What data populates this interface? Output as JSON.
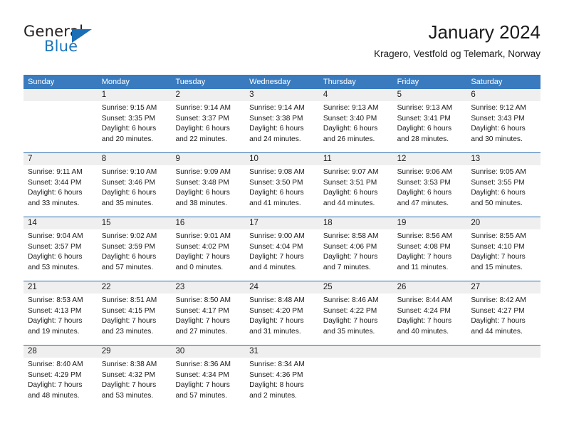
{
  "brand": {
    "name_top": "General",
    "name_bottom": "Blue",
    "triangle_icon": "blue-triangle-logo-icon",
    "color_dark": "#231f20",
    "color_blue": "#1d76bb"
  },
  "header": {
    "title": "January 2024",
    "subtitle": "Kragero, Vestfold og Telemark, Norway"
  },
  "theme": {
    "header_band": "#3a7bbf",
    "row_divider": "#2c6cad",
    "daynum_strip": "#efefef",
    "text": "#1a1a1a"
  },
  "weekdays": [
    "Sunday",
    "Monday",
    "Tuesday",
    "Wednesday",
    "Thursday",
    "Friday",
    "Saturday"
  ],
  "weeks": [
    {
      "numbers": [
        "",
        "1",
        "2",
        "3",
        "4",
        "5",
        "6"
      ],
      "cells": [
        {
          "lines": []
        },
        {
          "lines": [
            "Sunrise: 9:15 AM",
            "Sunset: 3:35 PM",
            "Daylight: 6 hours",
            "and 20 minutes."
          ]
        },
        {
          "lines": [
            "Sunrise: 9:14 AM",
            "Sunset: 3:37 PM",
            "Daylight: 6 hours",
            "and 22 minutes."
          ]
        },
        {
          "lines": [
            "Sunrise: 9:14 AM",
            "Sunset: 3:38 PM",
            "Daylight: 6 hours",
            "and 24 minutes."
          ]
        },
        {
          "lines": [
            "Sunrise: 9:13 AM",
            "Sunset: 3:40 PM",
            "Daylight: 6 hours",
            "and 26 minutes."
          ]
        },
        {
          "lines": [
            "Sunrise: 9:13 AM",
            "Sunset: 3:41 PM",
            "Daylight: 6 hours",
            "and 28 minutes."
          ]
        },
        {
          "lines": [
            "Sunrise: 9:12 AM",
            "Sunset: 3:43 PM",
            "Daylight: 6 hours",
            "and 30 minutes."
          ]
        }
      ]
    },
    {
      "numbers": [
        "7",
        "8",
        "9",
        "10",
        "11",
        "12",
        "13"
      ],
      "cells": [
        {
          "lines": [
            "Sunrise: 9:11 AM",
            "Sunset: 3:44 PM",
            "Daylight: 6 hours",
            "and 33 minutes."
          ]
        },
        {
          "lines": [
            "Sunrise: 9:10 AM",
            "Sunset: 3:46 PM",
            "Daylight: 6 hours",
            "and 35 minutes."
          ]
        },
        {
          "lines": [
            "Sunrise: 9:09 AM",
            "Sunset: 3:48 PM",
            "Daylight: 6 hours",
            "and 38 minutes."
          ]
        },
        {
          "lines": [
            "Sunrise: 9:08 AM",
            "Sunset: 3:50 PM",
            "Daylight: 6 hours",
            "and 41 minutes."
          ]
        },
        {
          "lines": [
            "Sunrise: 9:07 AM",
            "Sunset: 3:51 PM",
            "Daylight: 6 hours",
            "and 44 minutes."
          ]
        },
        {
          "lines": [
            "Sunrise: 9:06 AM",
            "Sunset: 3:53 PM",
            "Daylight: 6 hours",
            "and 47 minutes."
          ]
        },
        {
          "lines": [
            "Sunrise: 9:05 AM",
            "Sunset: 3:55 PM",
            "Daylight: 6 hours",
            "and 50 minutes."
          ]
        }
      ]
    },
    {
      "numbers": [
        "14",
        "15",
        "16",
        "17",
        "18",
        "19",
        "20"
      ],
      "cells": [
        {
          "lines": [
            "Sunrise: 9:04 AM",
            "Sunset: 3:57 PM",
            "Daylight: 6 hours",
            "and 53 minutes."
          ]
        },
        {
          "lines": [
            "Sunrise: 9:02 AM",
            "Sunset: 3:59 PM",
            "Daylight: 6 hours",
            "and 57 minutes."
          ]
        },
        {
          "lines": [
            "Sunrise: 9:01 AM",
            "Sunset: 4:02 PM",
            "Daylight: 7 hours",
            "and 0 minutes."
          ]
        },
        {
          "lines": [
            "Sunrise: 9:00 AM",
            "Sunset: 4:04 PM",
            "Daylight: 7 hours",
            "and 4 minutes."
          ]
        },
        {
          "lines": [
            "Sunrise: 8:58 AM",
            "Sunset: 4:06 PM",
            "Daylight: 7 hours",
            "and 7 minutes."
          ]
        },
        {
          "lines": [
            "Sunrise: 8:56 AM",
            "Sunset: 4:08 PM",
            "Daylight: 7 hours",
            "and 11 minutes."
          ]
        },
        {
          "lines": [
            "Sunrise: 8:55 AM",
            "Sunset: 4:10 PM",
            "Daylight: 7 hours",
            "and 15 minutes."
          ]
        }
      ]
    },
    {
      "numbers": [
        "21",
        "22",
        "23",
        "24",
        "25",
        "26",
        "27"
      ],
      "cells": [
        {
          "lines": [
            "Sunrise: 8:53 AM",
            "Sunset: 4:13 PM",
            "Daylight: 7 hours",
            "and 19 minutes."
          ]
        },
        {
          "lines": [
            "Sunrise: 8:51 AM",
            "Sunset: 4:15 PM",
            "Daylight: 7 hours",
            "and 23 minutes."
          ]
        },
        {
          "lines": [
            "Sunrise: 8:50 AM",
            "Sunset: 4:17 PM",
            "Daylight: 7 hours",
            "and 27 minutes."
          ]
        },
        {
          "lines": [
            "Sunrise: 8:48 AM",
            "Sunset: 4:20 PM",
            "Daylight: 7 hours",
            "and 31 minutes."
          ]
        },
        {
          "lines": [
            "Sunrise: 8:46 AM",
            "Sunset: 4:22 PM",
            "Daylight: 7 hours",
            "and 35 minutes."
          ]
        },
        {
          "lines": [
            "Sunrise: 8:44 AM",
            "Sunset: 4:24 PM",
            "Daylight: 7 hours",
            "and 40 minutes."
          ]
        },
        {
          "lines": [
            "Sunrise: 8:42 AM",
            "Sunset: 4:27 PM",
            "Daylight: 7 hours",
            "and 44 minutes."
          ]
        }
      ]
    },
    {
      "numbers": [
        "28",
        "29",
        "30",
        "31",
        "",
        "",
        ""
      ],
      "cells": [
        {
          "lines": [
            "Sunrise: 8:40 AM",
            "Sunset: 4:29 PM",
            "Daylight: 7 hours",
            "and 48 minutes."
          ]
        },
        {
          "lines": [
            "Sunrise: 8:38 AM",
            "Sunset: 4:32 PM",
            "Daylight: 7 hours",
            "and 53 minutes."
          ]
        },
        {
          "lines": [
            "Sunrise: 8:36 AM",
            "Sunset: 4:34 PM",
            "Daylight: 7 hours",
            "and 57 minutes."
          ]
        },
        {
          "lines": [
            "Sunrise: 8:34 AM",
            "Sunset: 4:36 PM",
            "Daylight: 8 hours",
            "and 2 minutes."
          ]
        },
        {
          "lines": []
        },
        {
          "lines": []
        },
        {
          "lines": []
        }
      ]
    }
  ]
}
